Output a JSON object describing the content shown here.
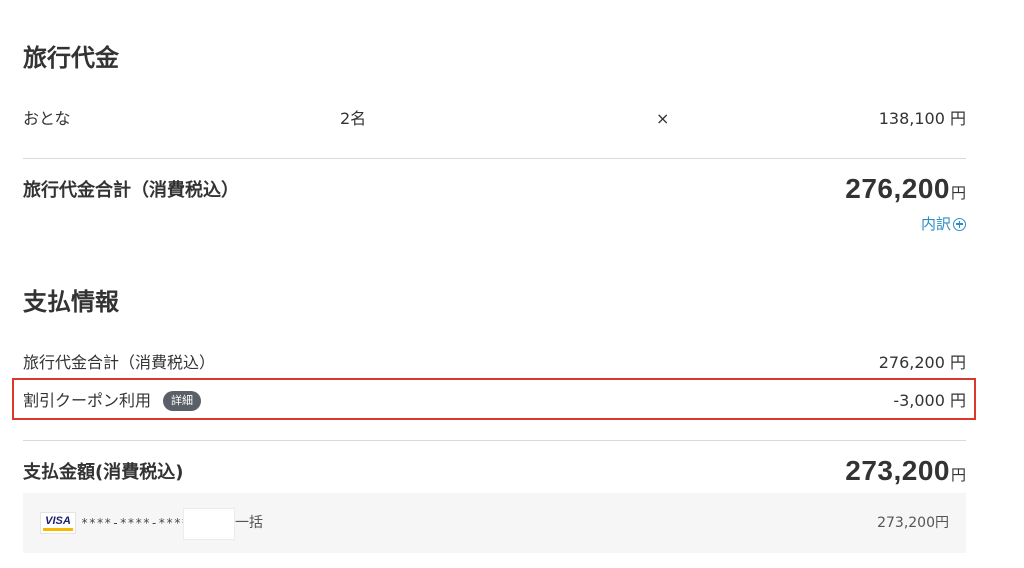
{
  "travel_fee": {
    "title": "旅行代金",
    "adult_label": "おとな",
    "count": "2名",
    "multiply": "×",
    "unit_price": "138,100 円",
    "total_label": "旅行代金合計（消費税込）",
    "total_amount": "276,200",
    "total_unit": "円",
    "breakdown_link": "内訳"
  },
  "payment_info": {
    "title": "支払情報",
    "subtotal_label": "旅行代金合計（消費税込）",
    "subtotal_value": "276,200 円",
    "coupon_label": "割引クーポン利用",
    "coupon_badge": "詳細",
    "coupon_value": "-3,000 円",
    "total_label": "支払金額(消費税込)",
    "total_amount": "273,200",
    "total_unit": "円",
    "card": {
      "brand": "VISA",
      "number": "****-****-****",
      "installment": "一括",
      "amount": "273,200円"
    }
  },
  "colors": {
    "highlight": "#d8392b",
    "link": "#2b8fc7",
    "badge_bg": "#5b6068"
  },
  "icons": {
    "breakdown": "plus-circle-icon",
    "card": "visa-logo"
  }
}
